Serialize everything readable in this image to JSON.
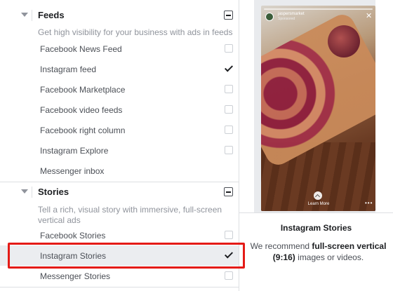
{
  "sections": {
    "feeds": {
      "title": "Feeds",
      "description": "Get high visibility for your business with ads in feeds",
      "items": [
        {
          "label": "Facebook News Feed",
          "checked": false
        },
        {
          "label": "Instagram feed",
          "checked": true
        },
        {
          "label": "Facebook Marketplace",
          "checked": false
        },
        {
          "label": "Facebook video feeds",
          "checked": false
        },
        {
          "label": "Facebook right column",
          "checked": false
        },
        {
          "label": "Instagram Explore",
          "checked": false
        },
        {
          "label": "Messenger inbox",
          "checked": null
        }
      ]
    },
    "stories": {
      "title": "Stories",
      "description_line1": "Tell a rich, visual story with immersive, full-screen",
      "description_line2": "vertical ads",
      "items": [
        {
          "label": "Facebook Stories",
          "checked": false
        },
        {
          "label": "Instagram Stories",
          "checked": true
        },
        {
          "label": "Messenger Stories",
          "checked": false
        }
      ]
    }
  },
  "preview": {
    "story_account": "jaspersmarket",
    "story_sponsored": "Sponsored",
    "story_cta": "Learn More",
    "title": "Instagram Stories",
    "note_prefix": "We recommend ",
    "note_bold": "full-screen vertical (9:16)",
    "note_suffix": " images or videos."
  },
  "colors": {
    "highlight_border": "#e41b17",
    "selected_row": "#ebedf0"
  }
}
